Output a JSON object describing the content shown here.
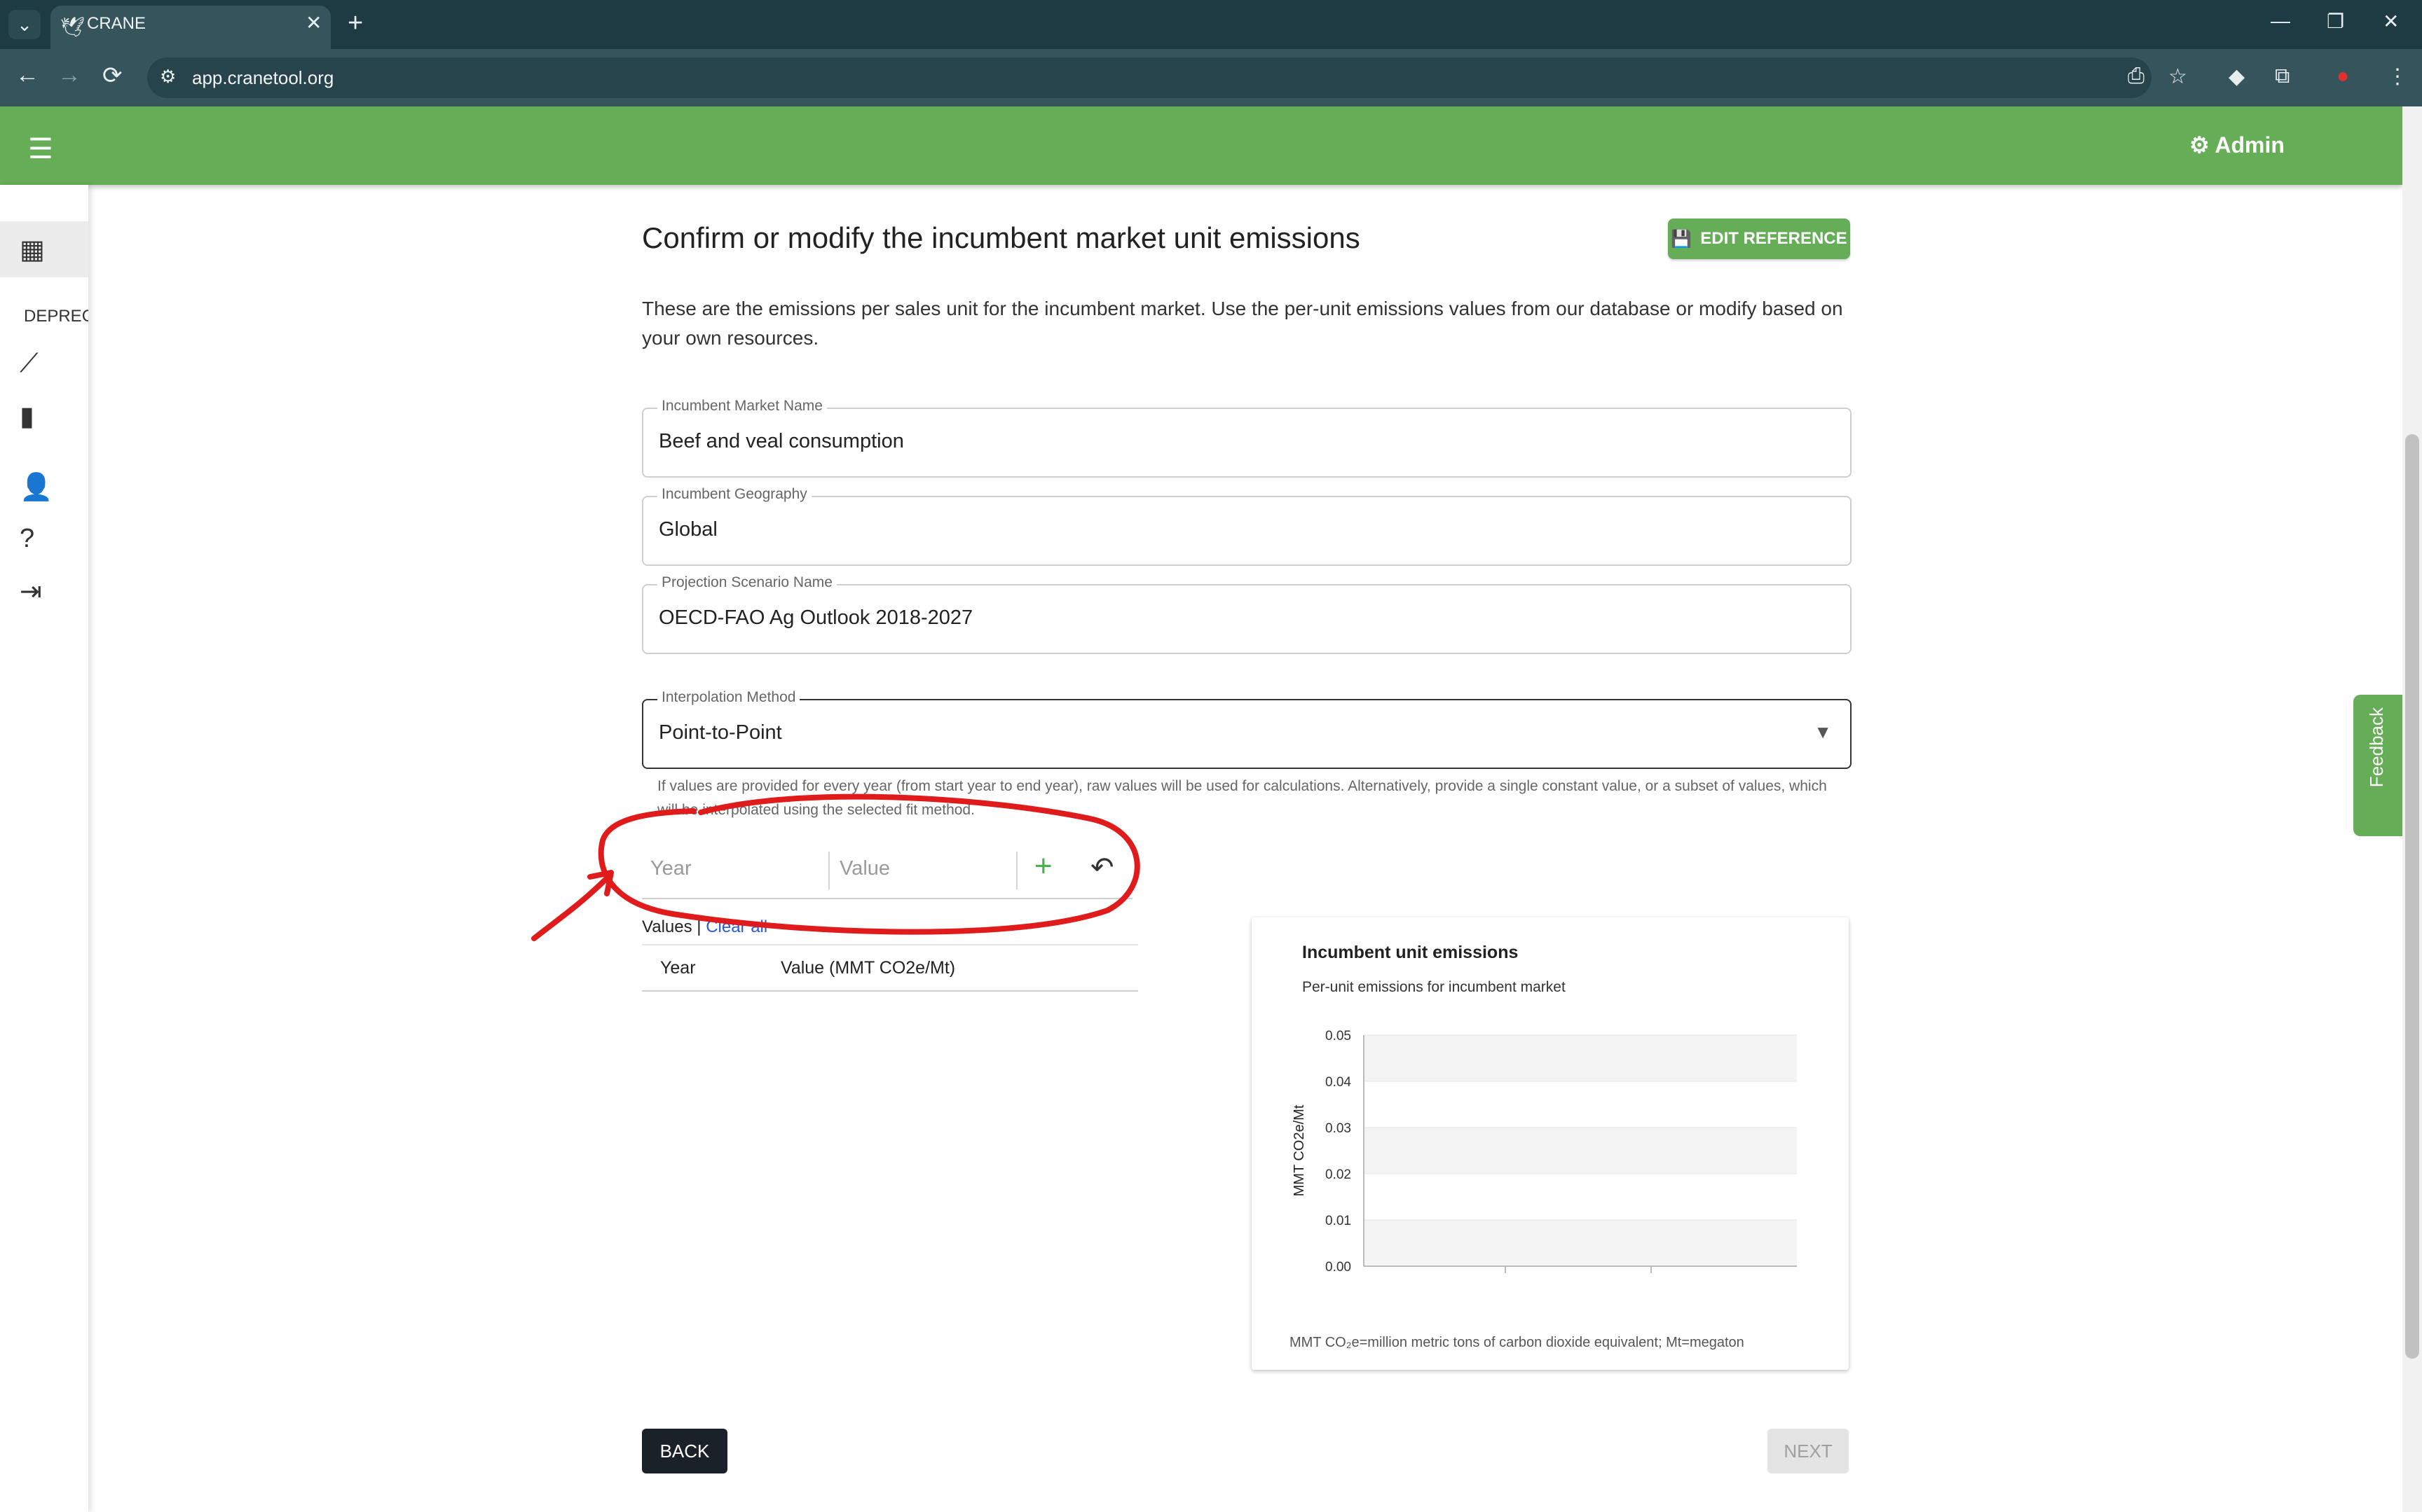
{
  "browser": {
    "tab_title": "CRANE",
    "url": "app.cranetool.org",
    "extension_badge": "1"
  },
  "appbar": {
    "admin_label": "Admin"
  },
  "sidebar": {
    "deprecated_label": "DEPRECATED",
    "icons": [
      "table-icon",
      "trend-line-icon",
      "bar-chart-icon",
      "person-icon",
      "help-icon",
      "logout-icon"
    ]
  },
  "feedback": {
    "label": "Feedback"
  },
  "main": {
    "title": "Confirm or modify the incumbent market unit emissions",
    "edit_reference_label": "EDIT REFERENCE",
    "intro": "These are the emissions per sales unit for the incumbent market. Use the per-unit emissions values from our database or modify based on your own resources.",
    "fields": {
      "market_name": {
        "label": "Incumbent Market Name",
        "value": "Beef and veal consumption"
      },
      "geography": {
        "label": "Incumbent Geography",
        "value": "Global"
      },
      "scenario": {
        "label": "Projection Scenario Name",
        "value": "OECD-FAO Ag Outlook 2018-2027"
      },
      "interpolation": {
        "label": "Interpolation Method",
        "value": "Point-to-Point"
      }
    },
    "helper_text": "If values are provided for every year (from start year to end year), raw values will be used for calculations. Alternatively, provide a single constant value, or a subset of values, which will be interpolated using the selected fit method.",
    "entry": {
      "year_placeholder": "Year",
      "value_placeholder": "Value"
    },
    "values_label": "Values",
    "values_separator": " | ",
    "clear_all_label": "Clear all",
    "table": {
      "col_year": "Year",
      "col_value": "Value (MMT CO2e/Mt)"
    },
    "back_label": "BACK",
    "next_label": "NEXT"
  },
  "chart_data": {
    "type": "line",
    "title": "Incumbent unit emissions",
    "subtitle": "Per-unit emissions for incumbent market",
    "ylabel": "MMT CO2e/Mt",
    "xlabel": "",
    "ylim": [
      0,
      0.05
    ],
    "yticks": [
      "0.05",
      "0.04",
      "0.03",
      "0.02",
      "0.01",
      "0.00"
    ],
    "series": [],
    "footnote": "MMT CO₂e=million metric tons of carbon dioxide equivalent; Mt=megaton"
  },
  "colors": {
    "brand_green": "#66ad57",
    "annotation_red": "#e01b1b",
    "link_blue": "#2a5ad6"
  }
}
